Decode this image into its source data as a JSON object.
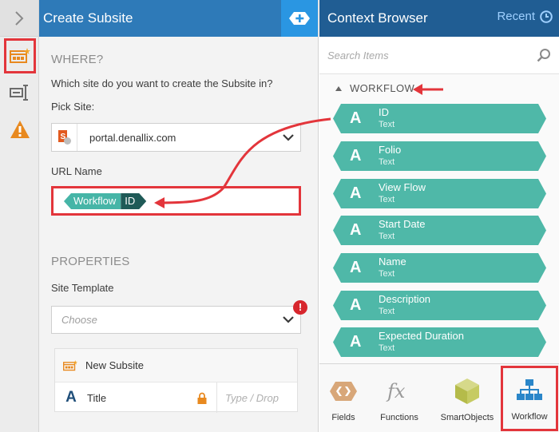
{
  "create_panel": {
    "title": "Create Subsite",
    "where_heading": "WHERE?",
    "where_question": "Which site do you want to create the Subsite in?",
    "pick_site_label": "Pick Site:",
    "pick_site_value": "portal.denallix.com",
    "url_name_label": "URL Name",
    "url_token": {
      "source": "Workflow",
      "field": "ID"
    },
    "properties_heading": "PROPERTIES",
    "site_template_label": "Site Template",
    "site_template_placeholder": "Choose",
    "error_mark": "!",
    "subsite_card": {
      "header": "New Subsite",
      "field_icon": "A",
      "field_label": "Title",
      "field_placeholder": "Type / Drop"
    }
  },
  "context_browser": {
    "title": "Context Browser",
    "recent_label": "Recent",
    "search_placeholder": "Search Items",
    "section": "WORKFLOW",
    "item_icon": "A",
    "items": [
      {
        "name": "ID",
        "type": "Text"
      },
      {
        "name": "Folio",
        "type": "Text"
      },
      {
        "name": "View Flow",
        "type": "Text"
      },
      {
        "name": "Start Date",
        "type": "Text"
      },
      {
        "name": "Name",
        "type": "Text"
      },
      {
        "name": "Description",
        "type": "Text"
      },
      {
        "name": "Expected Duration",
        "type": "Text"
      }
    ],
    "tabs": [
      {
        "label": "Fields",
        "icon": "fields-hexagon-icon"
      },
      {
        "label": "Functions",
        "icon": "fx-icon"
      },
      {
        "label": "SmartObjects",
        "icon": "cube-icon"
      },
      {
        "label": "Workflow",
        "icon": "workflow-tree-icon",
        "selected": true
      }
    ]
  },
  "colors": {
    "create_header": "#2e7ab8",
    "browser_header": "#205d93",
    "item_teal": "#4fb8a8",
    "token_dark": "#1f5a57",
    "highlight_red": "#e3353b"
  }
}
